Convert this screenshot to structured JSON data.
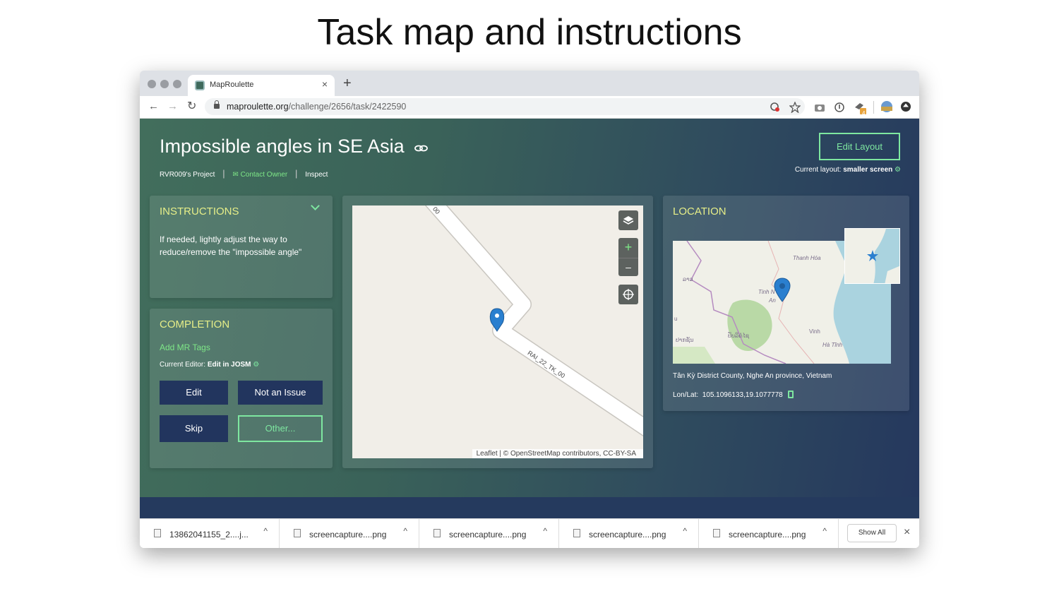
{
  "slide": {
    "title": "Task map and instructions"
  },
  "browser": {
    "tab_title": "MapRoulette",
    "tab_close": "×",
    "new_tab": "+",
    "url_domain": "maproulette.org",
    "url_path": "/challenge/2656/task/2422590",
    "nav_back": "←",
    "nav_forward": "→",
    "nav_reload": "↻",
    "extension_badge": "4"
  },
  "header": {
    "title": "Impossible angles in SE Asia",
    "project": "RVR009's Project",
    "contact_owner": "Contact Owner",
    "inspect": "Inspect",
    "edit_layout": "Edit Layout",
    "current_layout_label": "Current layout:",
    "current_layout_value": "smaller screen"
  },
  "instructions": {
    "heading": "INSTRUCTIONS",
    "text": "If needed, lightly adjust the way to reduce/remove the \"impossible angle\""
  },
  "completion": {
    "heading": "COMPLETION",
    "add_tags": "Add MR Tags",
    "editor_label": "Current Editor:",
    "editor_value": "Edit in JOSM",
    "buttons": {
      "edit": "Edit",
      "not_issue": "Not an Issue",
      "skip": "Skip",
      "other": "Other..."
    }
  },
  "task_map": {
    "road_label": "RAI_22_TK_00",
    "road_label_top": "00",
    "zoom_in": "+",
    "zoom_out": "–",
    "attribution": "Leaflet | © OpenStreetMap contributors, CC-BY-SA"
  },
  "location": {
    "heading": "LOCATION",
    "places": {
      "thanh_hoa": "Thanh Hóa",
      "laos": "ລາວ",
      "tinh_n": "Tinh N",
      "an": "An",
      "vinh": "Vinh",
      "ha_tinh": "Hà Tĩnh",
      "ban1": "ປັບລິຄໍໄຊ",
      "ban2": "ປາກຊັນ",
      "u": "u"
    },
    "address": "Tân Kỳ District County, Nghe An province, Vietnam",
    "lonlat_label": "Lon/Lat:",
    "lonlat_value": "105.1096133,19.1077778"
  },
  "downloads": {
    "items": [
      "13862041155_2....j...",
      "screencapture....png",
      "screencapture....png",
      "screencapture....png",
      "screencapture....png"
    ],
    "show_all": "Show All",
    "close": "×"
  },
  "colors": {
    "accent": "#7ee7a0",
    "heading": "#e6ee88",
    "button_dark": "#22355e",
    "marker": "#2a7fcf"
  },
  "icons": [
    "link-icon",
    "envelope-icon",
    "gear-icon",
    "chevron-down-icon",
    "layers-icon",
    "locate-icon",
    "map-marker-icon",
    "star-icon",
    "clipboard-icon",
    "file-icon",
    "caret-up-icon"
  ]
}
